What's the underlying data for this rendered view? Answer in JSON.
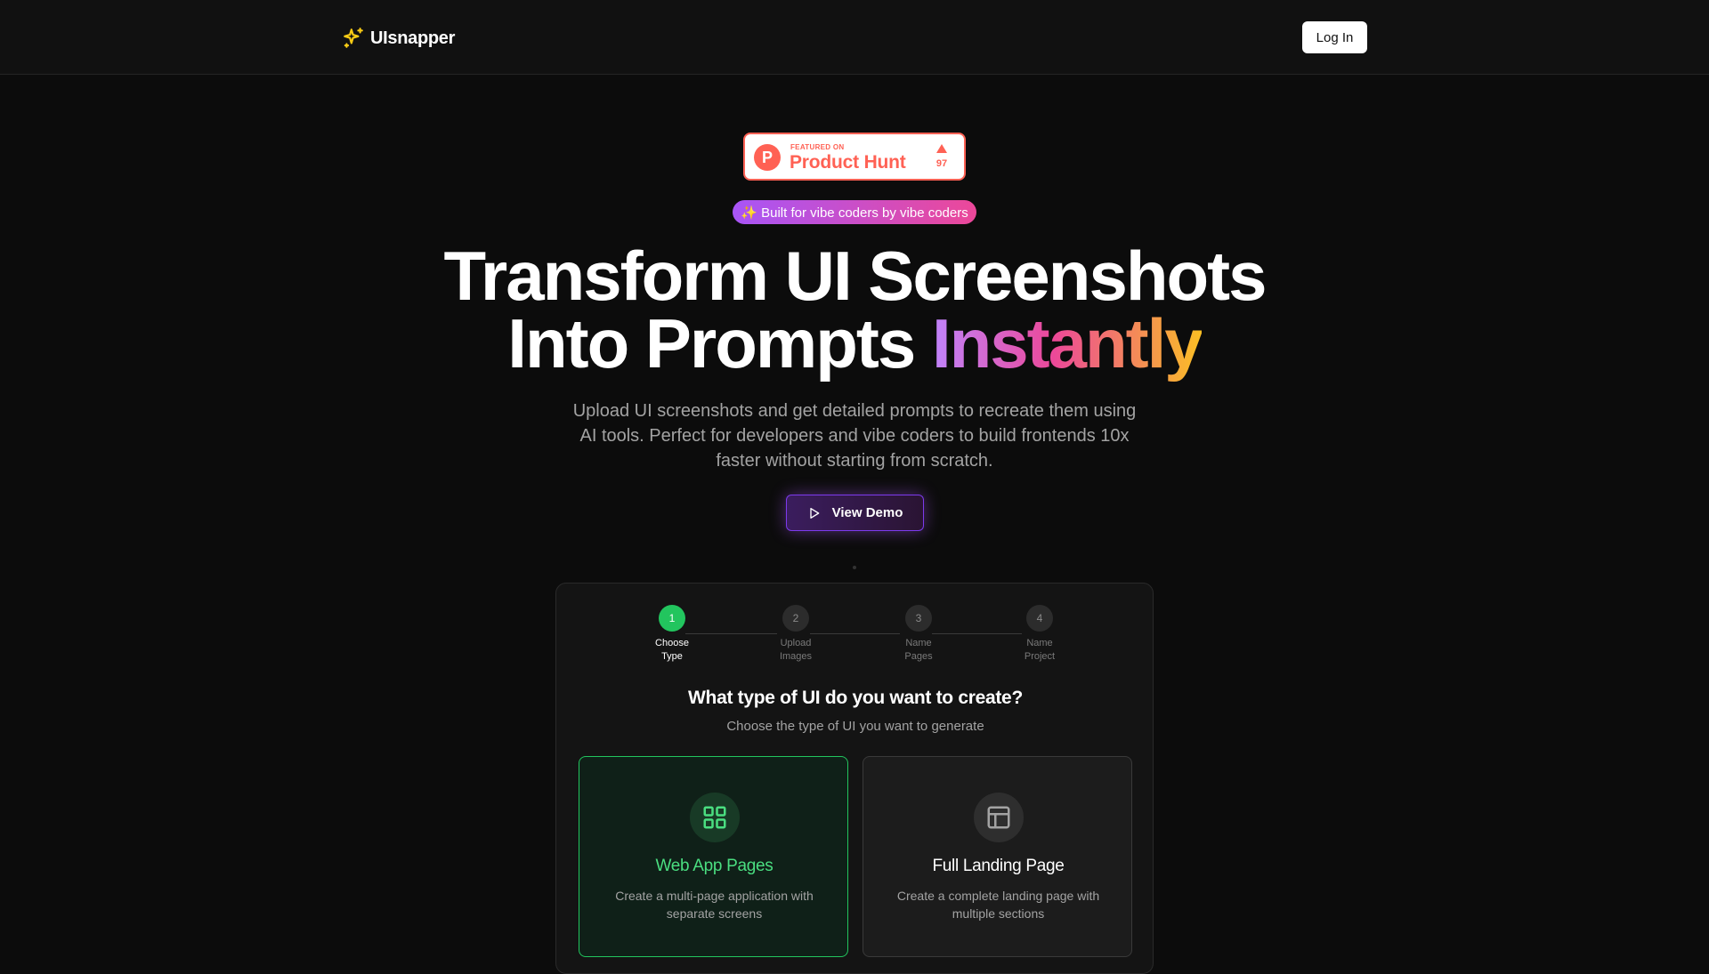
{
  "header": {
    "logo_text": "UIsnapper",
    "login_label": "Log In"
  },
  "product_hunt": {
    "small_label": "FEATURED ON",
    "big_label": "Product Hunt",
    "icon_letter": "P",
    "upvotes": "97"
  },
  "hero": {
    "pill": "✨ Built for vibe coders by vibe coders",
    "headline_line1": "Transform UI Screenshots",
    "headline_line2_plain": "Into Prompts",
    "headline_line2_gradient": "Instantly",
    "subtitle": "Upload UI screenshots and get detailed prompts to recreate them using AI tools. Perfect for developers and vibe coders to build frontends 10x faster without starting from scratch.",
    "demo_label": "View Demo"
  },
  "wizard": {
    "steps": [
      {
        "number": "1",
        "label_line1": "Choose",
        "label_line2": "Type"
      },
      {
        "number": "2",
        "label_line1": "Upload",
        "label_line2": "Images"
      },
      {
        "number": "3",
        "label_line1": "Name",
        "label_line2": "Pages"
      },
      {
        "number": "4",
        "label_line1": "Name",
        "label_line2": "Project"
      }
    ],
    "active_step": 1,
    "title": "What type of UI do you want to create?",
    "subtitle": "Choose the type of UI you want to generate",
    "options": [
      {
        "title": "Web App Pages",
        "description": "Create a multi-page application with separate screens",
        "icon": "grid-icon",
        "selected": true
      },
      {
        "title": "Full Landing Page",
        "description": "Create a complete landing page with multiple sections",
        "icon": "layout-icon",
        "selected": false
      }
    ]
  },
  "colors": {
    "accent_green": "#22c55e",
    "product_hunt": "#ff6154",
    "purple": "#a855f7",
    "pink": "#ec4899"
  }
}
